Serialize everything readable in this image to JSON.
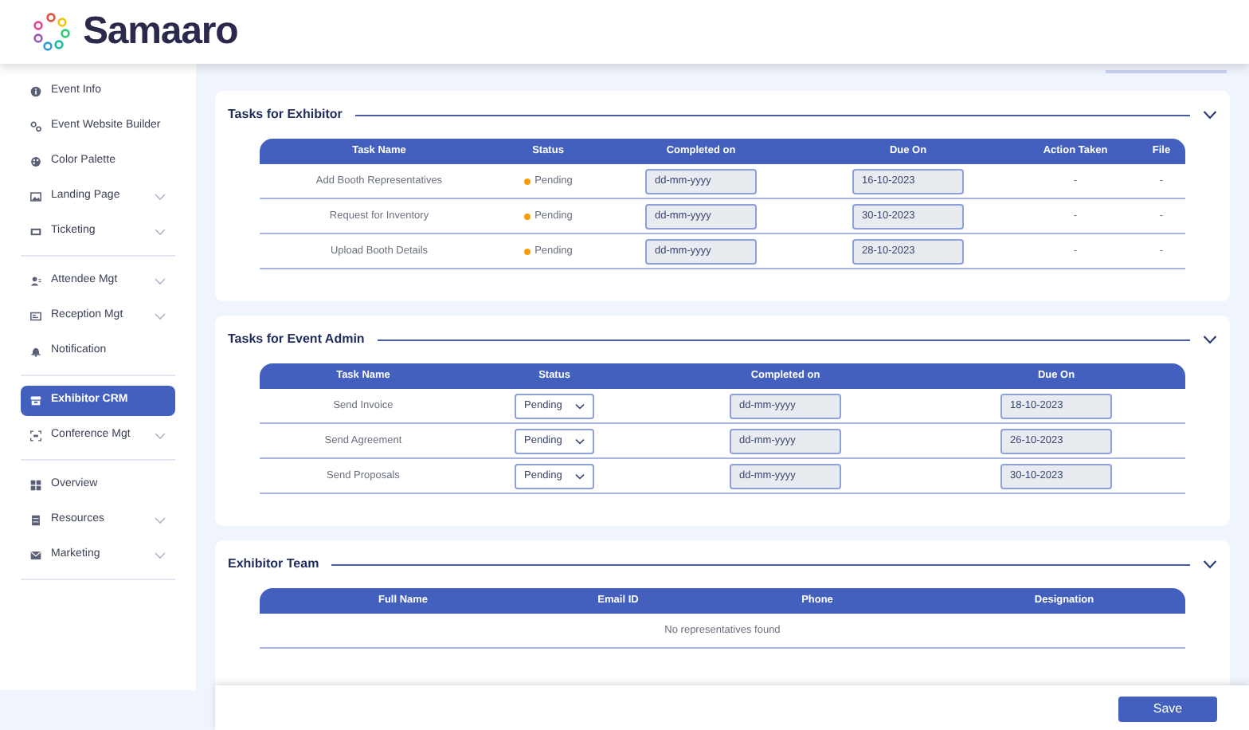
{
  "brand": {
    "name": "Samaaro"
  },
  "sidebar": {
    "groups": [
      [
        {
          "label": "Event Info",
          "expandable": false,
          "selected": false
        },
        {
          "label": "Event Website Builder",
          "expandable": false,
          "selected": false
        },
        {
          "label": "Color Palette",
          "expandable": false,
          "selected": false
        },
        {
          "label": "Landing Page",
          "expandable": true,
          "selected": false
        },
        {
          "label": "Ticketing",
          "expandable": true,
          "selected": false
        }
      ],
      [
        {
          "label": "Attendee Mgt",
          "expandable": true,
          "selected": false
        },
        {
          "label": "Reception Mgt",
          "expandable": true,
          "selected": false
        },
        {
          "label": "Notification",
          "expandable": false,
          "selected": false
        }
      ],
      [
        {
          "label": "Exhibitor CRM",
          "expandable": false,
          "selected": true
        },
        {
          "label": "Conference Mgt",
          "expandable": true,
          "selected": false
        }
      ],
      [
        {
          "label": "Overview",
          "expandable": false,
          "selected": false
        },
        {
          "label": "Resources",
          "expandable": true,
          "selected": false
        },
        {
          "label": "Marketing",
          "expandable": true,
          "selected": false
        }
      ]
    ]
  },
  "sections": [
    {
      "title": "Tasks for Exhibitor",
      "expanded": true,
      "columns": [
        "Task Name",
        "Status",
        "Completed on",
        "Due On",
        "Action Taken",
        "File"
      ],
      "rows": [
        [
          {
            "kind": "text",
            "text": "Add Booth Representatives"
          },
          {
            "kind": "status",
            "text": "Pending",
            "color": "#f59e0b"
          },
          {
            "kind": "date",
            "placeholder": "dd-mm-yyyy"
          },
          {
            "kind": "date",
            "value": "16-10-2023"
          },
          {
            "kind": "text",
            "text": "-"
          },
          {
            "kind": "text",
            "text": "-"
          }
        ],
        [
          {
            "kind": "text",
            "text": "Request for Inventory"
          },
          {
            "kind": "status",
            "text": "Pending",
            "color": "#f59e0b"
          },
          {
            "kind": "date",
            "placeholder": "dd-mm-yyyy"
          },
          {
            "kind": "date",
            "value": "30-10-2023"
          },
          {
            "kind": "text",
            "text": "-"
          },
          {
            "kind": "text",
            "text": "-"
          }
        ],
        [
          {
            "kind": "text",
            "text": "Upload Booth Details"
          },
          {
            "kind": "status",
            "text": "Pending",
            "color": "#f59e0b"
          },
          {
            "kind": "date",
            "placeholder": "dd-mm-yyyy"
          },
          {
            "kind": "date",
            "value": "28-10-2023"
          },
          {
            "kind": "text",
            "text": "-"
          },
          {
            "kind": "text",
            "text": "-"
          }
        ]
      ]
    },
    {
      "title": "Tasks for Event Admin",
      "expanded": true,
      "columns": [
        "Task Name",
        "Status",
        "Completed on",
        "Due On"
      ],
      "rows": [
        [
          {
            "kind": "text",
            "text": "Send Invoice"
          },
          {
            "kind": "select",
            "value": "Pending"
          },
          {
            "kind": "date",
            "placeholder": "dd-mm-yyyy"
          },
          {
            "kind": "date",
            "value": "18-10-2023"
          }
        ],
        [
          {
            "kind": "text",
            "text": "Send Agreement"
          },
          {
            "kind": "select",
            "value": "Pending"
          },
          {
            "kind": "date",
            "placeholder": "dd-mm-yyyy"
          },
          {
            "kind": "date",
            "value": "26-10-2023"
          }
        ],
        [
          {
            "kind": "text",
            "text": "Send Proposals"
          },
          {
            "kind": "select",
            "value": "Pending"
          },
          {
            "kind": "date",
            "placeholder": "dd-mm-yyyy"
          },
          {
            "kind": "date",
            "value": "30-10-2023"
          }
        ]
      ]
    },
    {
      "title": "Exhibitor Team",
      "expanded": true,
      "columns": [
        "Full Name",
        "Email ID",
        "Phone",
        "Designation"
      ],
      "empty_message": "No representatives found"
    }
  ],
  "footer": {
    "button": "Save"
  }
}
